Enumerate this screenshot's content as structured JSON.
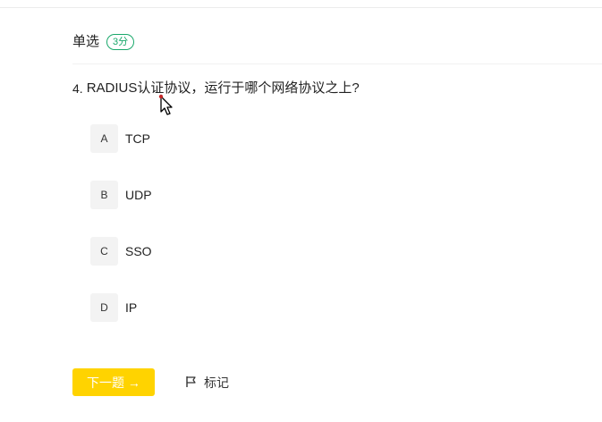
{
  "question": {
    "type_label": "单选",
    "score_badge": "3分",
    "number": "4.",
    "text": "RADIUS认证协议，运行于哪个网络协议之上?"
  },
  "options": [
    {
      "letter": "A",
      "text": "TCP"
    },
    {
      "letter": "B",
      "text": "UDP"
    },
    {
      "letter": "C",
      "text": "SSO"
    },
    {
      "letter": "D",
      "text": "IP"
    }
  ],
  "actions": {
    "next_label": "下一题 →",
    "mark_label": "标记"
  },
  "colors": {
    "accent_yellow": "#ffd300",
    "badge_green": "#1aa86b",
    "option_bg": "#f3f3f3"
  },
  "icons": {
    "mark": "flag-icon",
    "cursor": "mouse-pointer-icon"
  }
}
